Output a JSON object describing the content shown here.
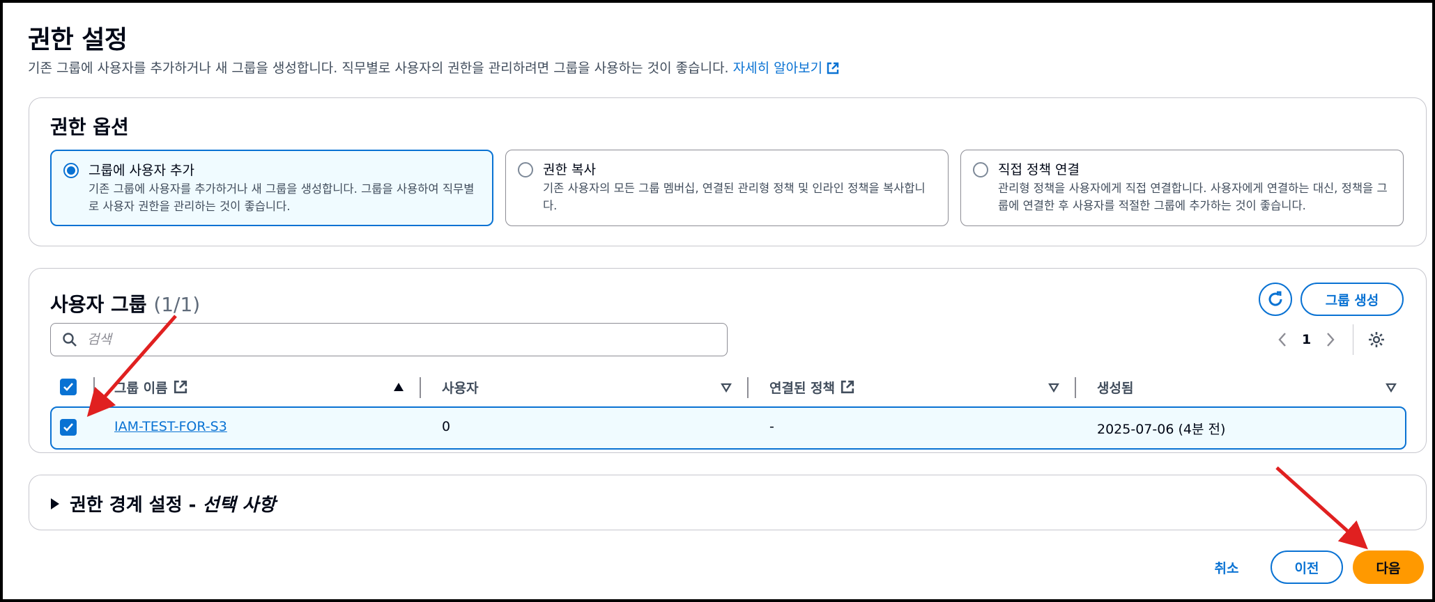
{
  "page": {
    "title": "권한 설정",
    "description": "기존 그룹에 사용자를 추가하거나 새 그룹을 생성합니다. 직무별로 사용자의 권한을 관리하려면 그룹을 사용하는 것이 좋습니다.",
    "learn_more": "자세히 알아보기"
  },
  "permission_options": {
    "title": "권한 옵션",
    "selected": "그룹에 사용자 추가",
    "options": [
      {
        "title": "그룹에 사용자 추가",
        "desc": "기존 그룹에 사용자를 추가하거나 새 그룹을 생성합니다. 그룹을 사용하여 직무별로 사용자 권한을 관리하는 것이 좋습니다."
      },
      {
        "title": "권한 복사",
        "desc": "기존 사용자의 모든 그룹 멤버십, 연결된 관리형 정책 및 인라인 정책을 복사합니다."
      },
      {
        "title": "직접 정책 연결",
        "desc": "관리형 정책을 사용자에게 직접 연결합니다. 사용자에게 연결하는 대신, 정책을 그룹에 연결한 후 사용자를 적절한 그룹에 추가하는 것이 좋습니다."
      }
    ]
  },
  "user_groups": {
    "title": "사용자 그룹",
    "count": "(1/1)",
    "create_label": "그룹 생성",
    "search_placeholder": "검색",
    "page": "1",
    "columns": [
      "그룹 이름",
      "사용자",
      "연결된 정책",
      "생성됨"
    ],
    "rows": [
      {
        "name": "IAM-TEST-FOR-S3",
        "users": "0",
        "policies": "-",
        "created": "2025-07-06 (4분 전)",
        "checked": true
      }
    ]
  },
  "boundary": {
    "title": "권한 경계 설정 - ",
    "optional": "선택 사항"
  },
  "footer": {
    "cancel": "취소",
    "previous": "이전",
    "next": "다음"
  },
  "colors": {
    "accent": "#0972d3",
    "primary_button": "#ff9900",
    "annotation_arrow": "#e02020"
  }
}
